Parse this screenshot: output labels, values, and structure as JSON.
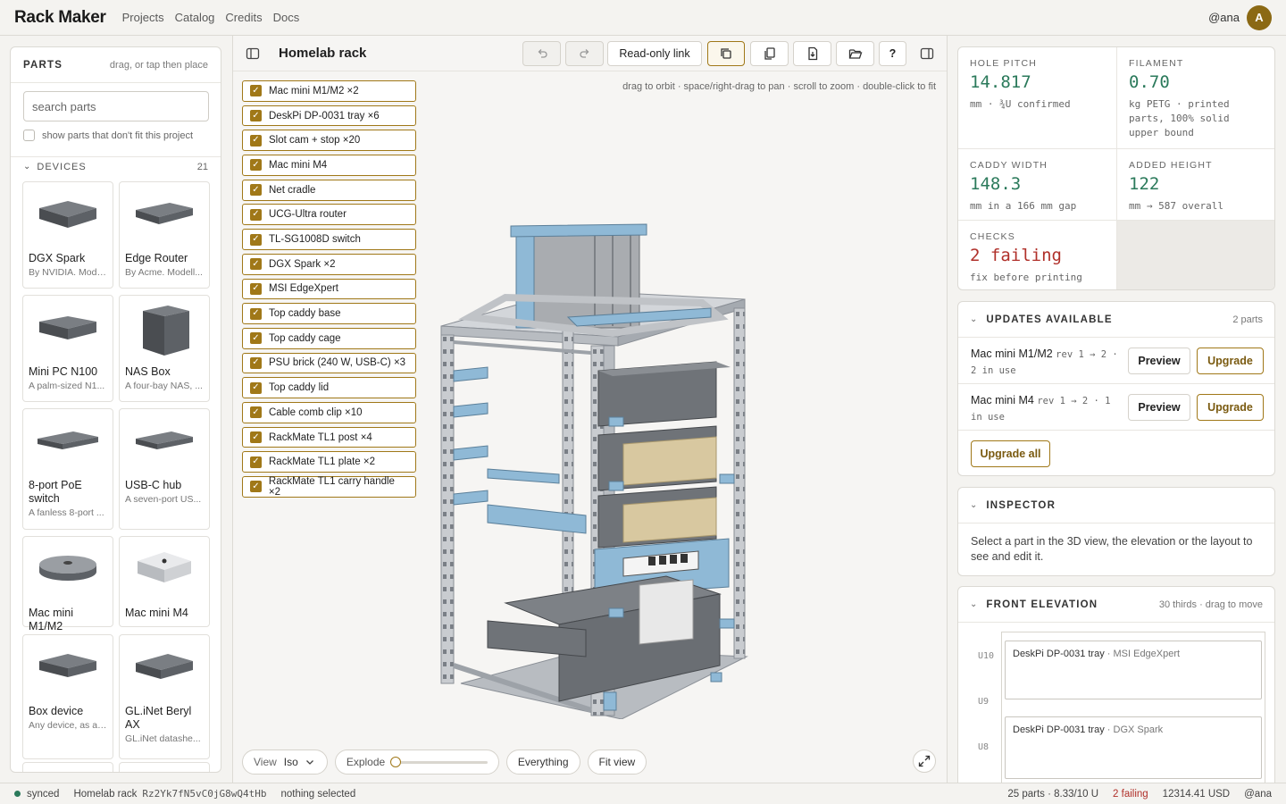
{
  "app": {
    "brand": "Rack Maker",
    "nav": [
      "Projects",
      "Catalog",
      "Credits",
      "Docs"
    ],
    "user_handle": "@ana",
    "avatar_letter": "A",
    "accent": "#a07818"
  },
  "parts": {
    "title": "PARTS",
    "hint": "drag, or tap then place",
    "search_placeholder": "search parts",
    "show_unfit_label": "show parts that don't fit this project",
    "devices_label": "DEVICES",
    "devices_count": "21",
    "devices": [
      {
        "name": "DGX Spark",
        "desc": "By NVIDIA. Model...",
        "icon": "mini-box-icon"
      },
      {
        "name": "Edge Router",
        "desc": "By Acme. Modell...",
        "icon": "router-icon"
      },
      {
        "name": "Mini PC N100",
        "desc": "A palm-sized N1...",
        "icon": "mini-pc-icon"
      },
      {
        "name": "NAS Box",
        "desc": "A four-bay NAS, ...",
        "icon": "nas-icon"
      },
      {
        "name": "8-port PoE switch",
        "desc": "A fanless 8-port ...",
        "icon": "switch-icon"
      },
      {
        "name": "USB-C hub",
        "desc": "A seven-port US...",
        "icon": "hub-icon"
      },
      {
        "name": "Mac mini M1/M2",
        "desc": "",
        "icon": "mac-mini-icon"
      },
      {
        "name": "Mac mini M4",
        "desc": "",
        "icon": "mac-mini-m4-icon"
      },
      {
        "name": "Box device",
        "desc": "Any device, as a ...",
        "icon": "box-icon"
      },
      {
        "name": "GL.iNet Beryl AX",
        "desc": "GL.iNet datashe...",
        "icon": "beryl-icon"
      }
    ]
  },
  "viewport": {
    "project_title": "Homelab rack",
    "readonly_link_label": "Read-only link",
    "help_label": "?",
    "hint": "drag to orbit · space/right-drag to pan · scroll to zoom · double-click to fit",
    "checklist": [
      "Mac mini M1/M2 ×2",
      "DeskPi DP-0031 tray ×6",
      "Slot cam + stop ×20",
      "Mac mini M4",
      "Net cradle",
      "UCG-Ultra router",
      "TL-SG1008D switch",
      "DGX Spark ×2",
      "MSI EdgeXpert",
      "Top caddy base",
      "Top caddy cage",
      "PSU brick (240 W, USB-C) ×3",
      "Top caddy lid",
      "Cable comb clip ×10",
      "RackMate TL1 post ×4",
      "RackMate TL1 plate ×2",
      "RackMate TL1 carry handle ×2"
    ],
    "view_label": "View",
    "view_value": "Iso",
    "explode_label": "Explode",
    "explode_value": 0,
    "everything_label": "Everything",
    "fit_view_label": "Fit view"
  },
  "stats": {
    "hole_pitch": {
      "label": "HOLE PITCH",
      "value": "14.817",
      "sub": "mm · ¾U confirmed"
    },
    "filament": {
      "label": "FILAMENT",
      "value": "0.70",
      "sub": "kg PETG · printed parts, 100% solid upper bound"
    },
    "caddy_width": {
      "label": "CADDY WIDTH",
      "value": "148.3",
      "sub": "mm in a 166 mm gap"
    },
    "added_height": {
      "label": "ADDED HEIGHT",
      "value": "122",
      "sub": "mm → 587 overall"
    },
    "checks": {
      "label": "CHECKS",
      "value": "2 failing",
      "sub": "fix before printing"
    }
  },
  "updates": {
    "title": "UPDATES AVAILABLE",
    "meta": "2 parts",
    "items": [
      {
        "name": "Mac mini M1/M2",
        "rev": "rev 1 → 2 · 2 in use"
      },
      {
        "name": "Mac mini M4",
        "rev": "rev 1 → 2 · 1 in use"
      }
    ],
    "preview_label": "Preview",
    "upgrade_label": "Upgrade",
    "upgrade_all_label": "Upgrade all"
  },
  "inspector": {
    "title": "INSPECTOR",
    "body": "Select a part in the 3D view, the elevation or the layout to see and edit it."
  },
  "elevation": {
    "title": "FRONT ELEVATION",
    "meta": "30 thirds · drag to move",
    "u_labels": [
      "U10",
      "U9",
      "U8"
    ],
    "slots": [
      {
        "name": "DeskPi DP-0031 tray",
        "sub": " · MSI EdgeXpert"
      },
      {
        "name": "DeskPi DP-0031 tray",
        "sub": " · DGX Spark"
      }
    ]
  },
  "status": {
    "sync": "synced",
    "project": "Homelab rack",
    "project_id": "Rz2Yk7fN5vC0jG8wQ4tHb",
    "selection": "nothing selected",
    "summary": "25 parts · 8.33/10 U",
    "failing": "2 failing",
    "price": "12314.41 USD",
    "user": "@ana"
  }
}
